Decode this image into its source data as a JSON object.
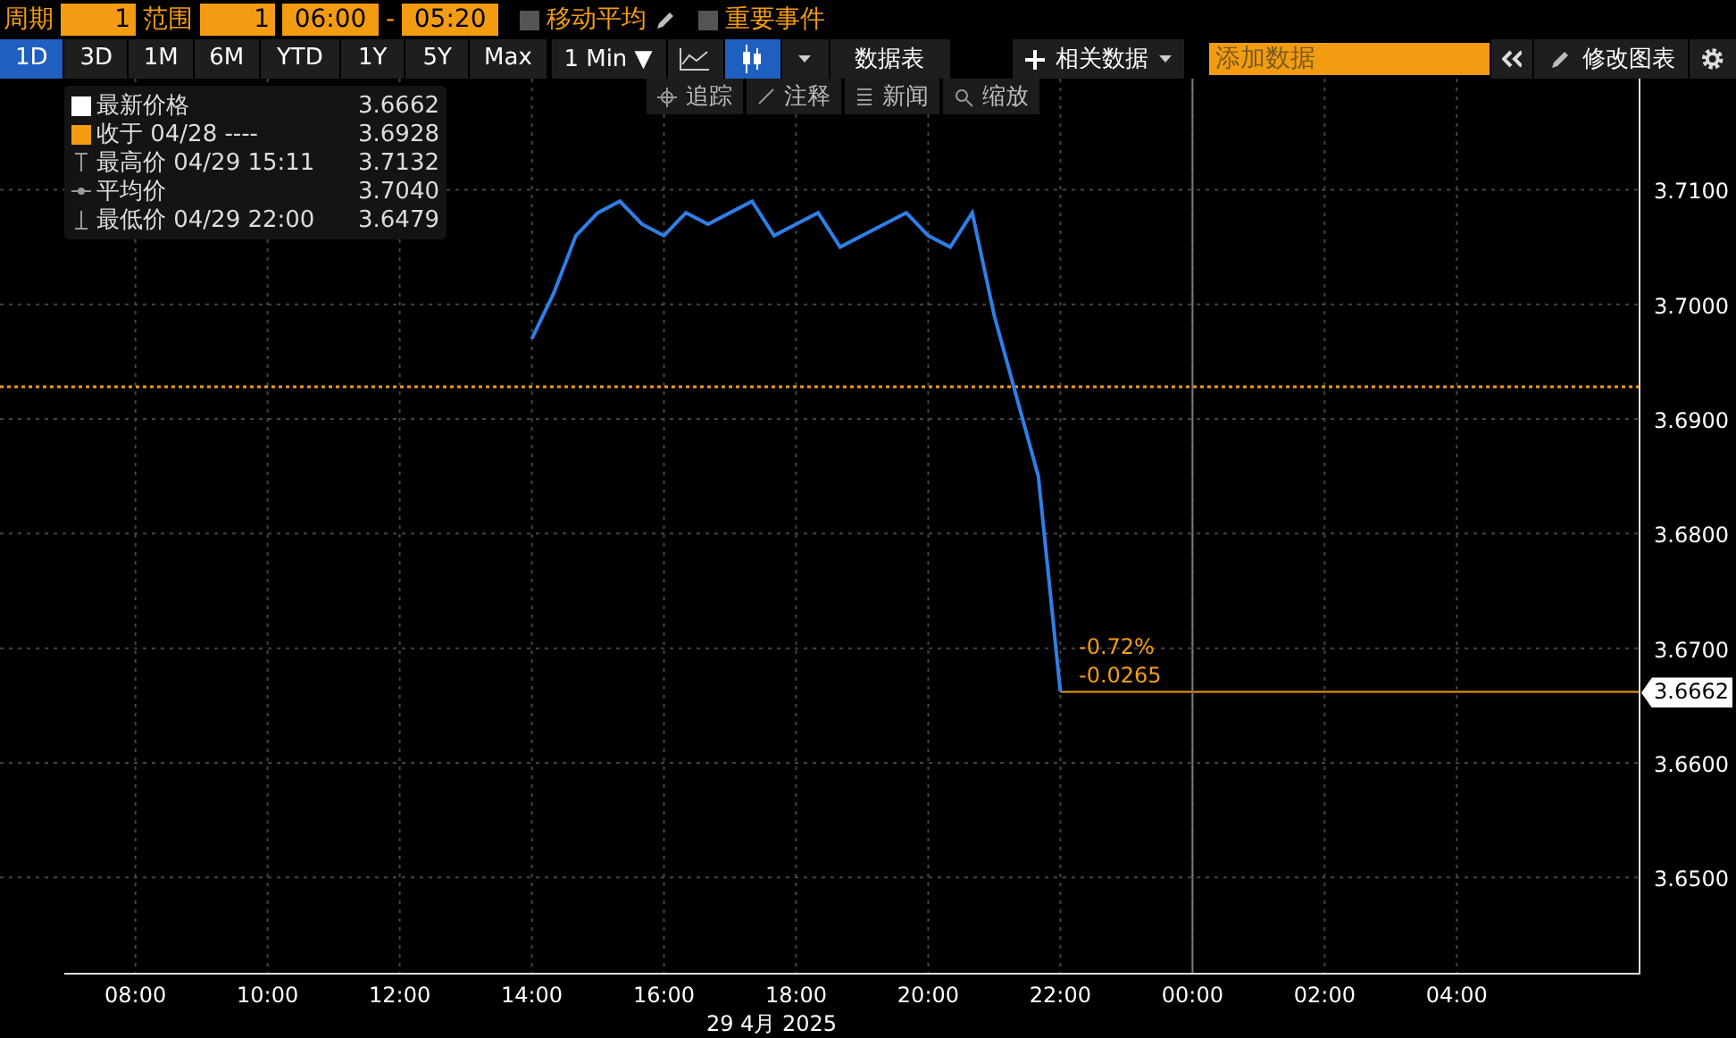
{
  "top_bar": {
    "period_label": "周期",
    "period_value": "1",
    "range_label": "范围",
    "range_value": "1",
    "start_time": "06:00",
    "separator": "-",
    "end_time": "05:20",
    "toggles": [
      {
        "label": "移动平均",
        "checked": false,
        "editable": true
      },
      {
        "label": "重要事件",
        "checked": false,
        "editable": false
      }
    ]
  },
  "toolbar": {
    "ranges": [
      {
        "label": "1D",
        "selected": true
      },
      {
        "label": "3D",
        "selected": false
      },
      {
        "label": "1M",
        "selected": false
      },
      {
        "label": "6M",
        "selected": false
      },
      {
        "label": "YTD",
        "selected": false
      },
      {
        "label": "1Y",
        "selected": false
      },
      {
        "label": "5Y",
        "selected": false
      },
      {
        "label": "Max",
        "selected": false
      }
    ],
    "interval": "1 Min ▼",
    "chart_types": [
      {
        "kind": "line",
        "selected": false
      },
      {
        "kind": "candle",
        "selected": true
      }
    ],
    "data_table": "数据表",
    "related_data": "相关数据",
    "add_data": {
      "placeholder": "添加数据"
    },
    "edit_chart": "修改图表"
  },
  "chart_tools": [
    {
      "kind": "track",
      "label": "追踪"
    },
    {
      "kind": "annotate",
      "label": "注释"
    },
    {
      "kind": "news",
      "label": "新闻"
    },
    {
      "kind": "zoom",
      "label": "缩放"
    }
  ],
  "legend": [
    {
      "kind": "last",
      "label": "最新价格",
      "value": "3.6662",
      "color": "#ffffff"
    },
    {
      "kind": "close",
      "label": "收于 04/28 ----",
      "value": "3.6928",
      "color": "#f39c12"
    },
    {
      "kind": "high",
      "label": "最高价 04/29 15:11",
      "value": "3.7132"
    },
    {
      "kind": "average",
      "label": "平均价",
      "value": "3.7040"
    },
    {
      "kind": "low",
      "label": "最低价 04/29 22:00",
      "value": "3.6479"
    }
  ],
  "chart": {
    "last_price_tag": "3.6662",
    "change_percent": "-0.72%",
    "change": "-0.0265",
    "date_label": "29 4月 2025",
    "chart_data": {
      "type": "line",
      "grid": true,
      "xlim": [
        "2025-04-29T05:57",
        "2025-04-30T06:46"
      ],
      "ylim": [
        3.6416,
        3.7197
      ],
      "x": [
        "2025-04-29T14:00",
        "2025-04-29T14:20",
        "2025-04-29T14:40",
        "2025-04-29T15:00",
        "2025-04-29T15:20",
        "2025-04-29T15:40",
        "2025-04-29T16:00",
        "2025-04-29T16:20",
        "2025-04-29T16:40",
        "2025-04-29T17:00",
        "2025-04-29T17:20",
        "2025-04-29T17:40",
        "2025-04-29T18:00",
        "2025-04-29T18:20",
        "2025-04-29T18:40",
        "2025-04-29T19:00",
        "2025-04-29T19:20",
        "2025-04-29T19:40",
        "2025-04-29T20:00",
        "2025-04-29T20:20",
        "2025-04-29T20:40",
        "2025-04-29T21:00",
        "2025-04-29T21:20",
        "2025-04-29T21:40",
        "2025-04-29T22:00"
      ],
      "series": [
        {
          "color": "#2f7fe8",
          "values": [
            3.697,
            3.701,
            3.706,
            3.708,
            3.709,
            3.707,
            3.706,
            3.708,
            3.707,
            3.708,
            3.709,
            3.706,
            3.707,
            3.708,
            3.705,
            3.706,
            3.707,
            3.708,
            3.706,
            3.705,
            3.708,
            3.699,
            3.692,
            3.685,
            3.6662
          ]
        }
      ],
      "ref_lines": [
        {
          "axis": "y",
          "value": 3.6928,
          "color": "#f39c12"
        },
        {
          "axis": "y",
          "value": 3.6662,
          "color": "#f39c12"
        },
        {
          "axis": "x",
          "value": "2025-04-30T00:00",
          "color": "#777777"
        }
      ],
      "xticks": [
        {
          "value": "2025-04-29T08:00",
          "label": "08:00"
        },
        {
          "value": "2025-04-29T10:00",
          "label": "10:00"
        },
        {
          "value": "2025-04-29T12:00",
          "label": "12:00"
        },
        {
          "value": "2025-04-29T14:00",
          "label": "14:00"
        },
        {
          "value": "2025-04-29T16:00",
          "label": "16:00"
        },
        {
          "value": "2025-04-29T18:00",
          "label": "18:00"
        },
        {
          "value": "2025-04-29T20:00",
          "label": "20:00"
        },
        {
          "value": "2025-04-29T22:00",
          "label": "22:00"
        },
        {
          "value": "2025-04-30T00:00",
          "label": "00:00"
        },
        {
          "value": "2025-04-30T02:00",
          "label": "02:00"
        },
        {
          "value": "2025-04-30T04:00",
          "label": "04:00"
        }
      ],
      "yticks": [
        {
          "value": 3.71,
          "label": "3.7100"
        },
        {
          "value": 3.7,
          "label": "3.7000"
        },
        {
          "value": 3.69,
          "label": "3.6900"
        },
        {
          "value": 3.68,
          "label": "3.6800"
        },
        {
          "value": 3.67,
          "label": "3.6700"
        },
        {
          "value": 3.66,
          "label": "3.6600"
        },
        {
          "value": 3.65,
          "label": "3.6500"
        }
      ]
    }
  }
}
